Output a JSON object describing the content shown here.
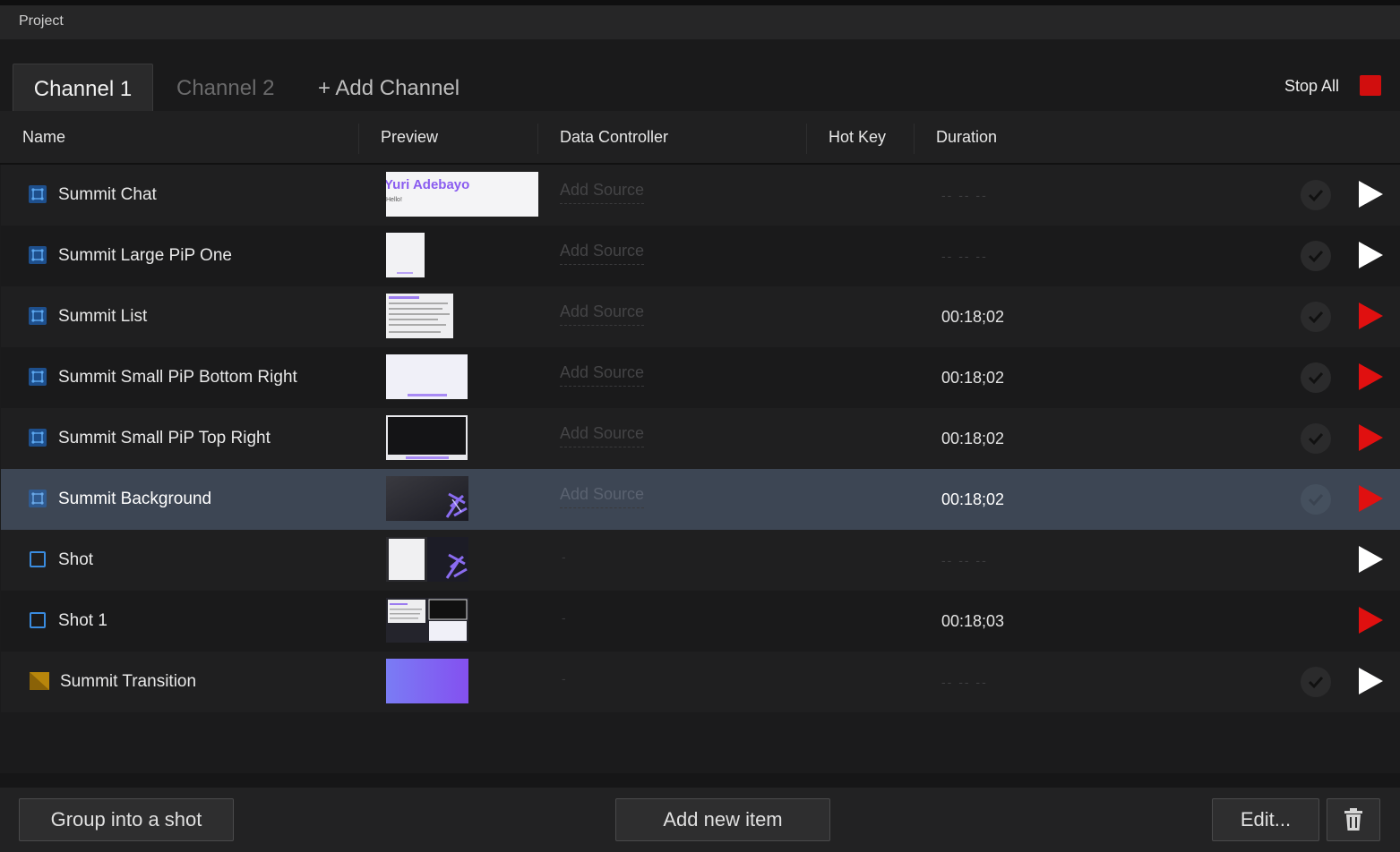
{
  "window": {
    "title": "Project"
  },
  "tabs": [
    {
      "label": "Channel 1"
    },
    {
      "label": "Channel 2"
    },
    {
      "label": "+ Add Channel"
    }
  ],
  "stop_all": {
    "label": "Stop All",
    "color": "#d10e0e"
  },
  "columns": {
    "name": "Name",
    "preview": "Preview",
    "data_controller": "Data Controller",
    "hot_key": "Hot Key",
    "duration": "Duration"
  },
  "rows": [
    {
      "name": "Summit Chat",
      "icon": "effect-icon",
      "data_controller": "Add Source",
      "duration": "-- -- --",
      "play_color": "white"
    },
    {
      "name": "Summit Large PiP One",
      "icon": "effect-icon",
      "data_controller": "Add Source",
      "duration": "-- -- --",
      "play_color": "white"
    },
    {
      "name": "Summit List",
      "icon": "effect-icon",
      "data_controller": "Add Source",
      "duration": "00:18;02",
      "play_color": "red"
    },
    {
      "name": "Summit Small PiP Bottom Right",
      "icon": "effect-icon",
      "data_controller": "Add Source",
      "duration": "00:18;02",
      "play_color": "red"
    },
    {
      "name": "Summit Small PiP Top Right",
      "icon": "effect-icon",
      "data_controller": "Add Source",
      "duration": "00:18;02",
      "play_color": "red"
    },
    {
      "name": "Summit Background",
      "icon": "effect-icon",
      "data_controller": "Add Source",
      "duration": "00:18;02",
      "play_color": "red",
      "selected": true
    },
    {
      "name": "Shot",
      "icon": "shot-icon",
      "data_controller": "-",
      "duration": "-- -- --",
      "play_color": "white"
    },
    {
      "name": "Shot 1",
      "icon": "shot-icon",
      "data_controller": "-",
      "duration": "00:18;03",
      "play_color": "red"
    },
    {
      "name": "Summit Transition",
      "icon": "transition-icon",
      "data_controller": "-",
      "duration": "-- -- --",
      "play_color": "white"
    }
  ],
  "previews": {
    "chat_name": "Yuri Adebayo",
    "chat_sub": "Hello!"
  },
  "footer": {
    "group_label": "Group into a shot",
    "add_label": "Add new item",
    "edit_label": "Edit..."
  },
  "colors": {
    "accent_blue": "#3a8ce0",
    "play_red": "#e01010",
    "purple": "#7b55f0"
  }
}
